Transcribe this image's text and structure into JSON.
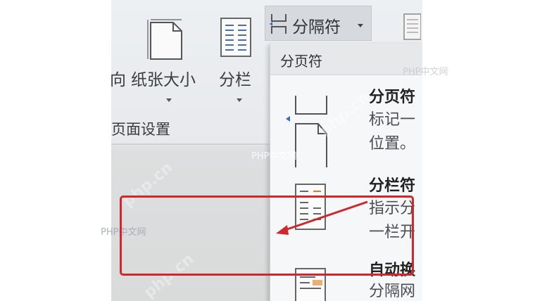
{
  "ribbon": {
    "orientation_fragment": "向",
    "paper_size_label": "纸张大小",
    "columns_label": "分栏",
    "group_label": "页面设置",
    "breaks_button_label": "分隔符"
  },
  "menu": {
    "header": "分页符",
    "items": [
      {
        "title": "分页符",
        "desc_line1": "标记一",
        "desc_line2": "位置。"
      },
      {
        "title": "分栏符",
        "desc_line1": "指示分",
        "desc_line2": "一栏开"
      },
      {
        "title": "自动换",
        "desc_line1": "分隔网",
        "desc_line2": ""
      }
    ]
  },
  "watermarks": {
    "top_right": "PHP中文网",
    "center": "PHP中文网",
    "left": "PHP中文网",
    "diagonal": "php.cn"
  },
  "annotation": {
    "highlight_color": "#d0262c"
  }
}
